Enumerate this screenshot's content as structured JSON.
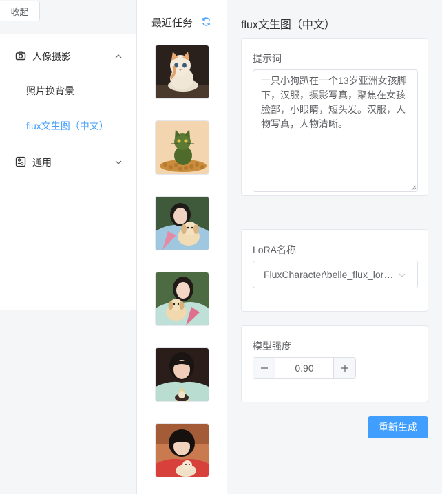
{
  "sidebar": {
    "collapse_label": "收起",
    "groups": [
      {
        "label": "人像摄影",
        "icon": "camera-icon",
        "expanded": true
      },
      {
        "label": "通用",
        "icon": "settings-sliders-icon",
        "expanded": false
      }
    ],
    "items": [
      {
        "label": "照片换背景",
        "active": false
      },
      {
        "label": "flux文生图（中文）",
        "active": true
      }
    ]
  },
  "recent": {
    "title": "最近任务",
    "refresh_icon": "refresh-icon",
    "thumbnails": [
      {
        "subject": "cat figurine"
      },
      {
        "subject": "green cat sculpture on beans"
      },
      {
        "subject": "girl in hanbok holding puppy"
      },
      {
        "subject": "girl in hanbok holding puppy"
      },
      {
        "subject": "girl in hanbok with puppy"
      },
      {
        "subject": "girl with puppy"
      }
    ]
  },
  "main": {
    "title": "flux文生图（中文）",
    "prompt": {
      "label": "提示词",
      "value": "一只小狗趴在一个13岁亚洲女孩脚下，汉服，摄影写真，聚焦在女孩脸部，小眼睛，短头发。汉服，人物写真，人物清晰。"
    },
    "lora": {
      "label": "LoRA名称",
      "value": "FluxCharacter\\belle_flux_lora.safetensors"
    },
    "strength": {
      "label": "模型强度",
      "value": "0.90"
    },
    "submit_label": "重新生成"
  },
  "colors": {
    "accent": "#409eff",
    "sidebar_bg": "#f4f6f8",
    "border": "#e4e7ed"
  }
}
